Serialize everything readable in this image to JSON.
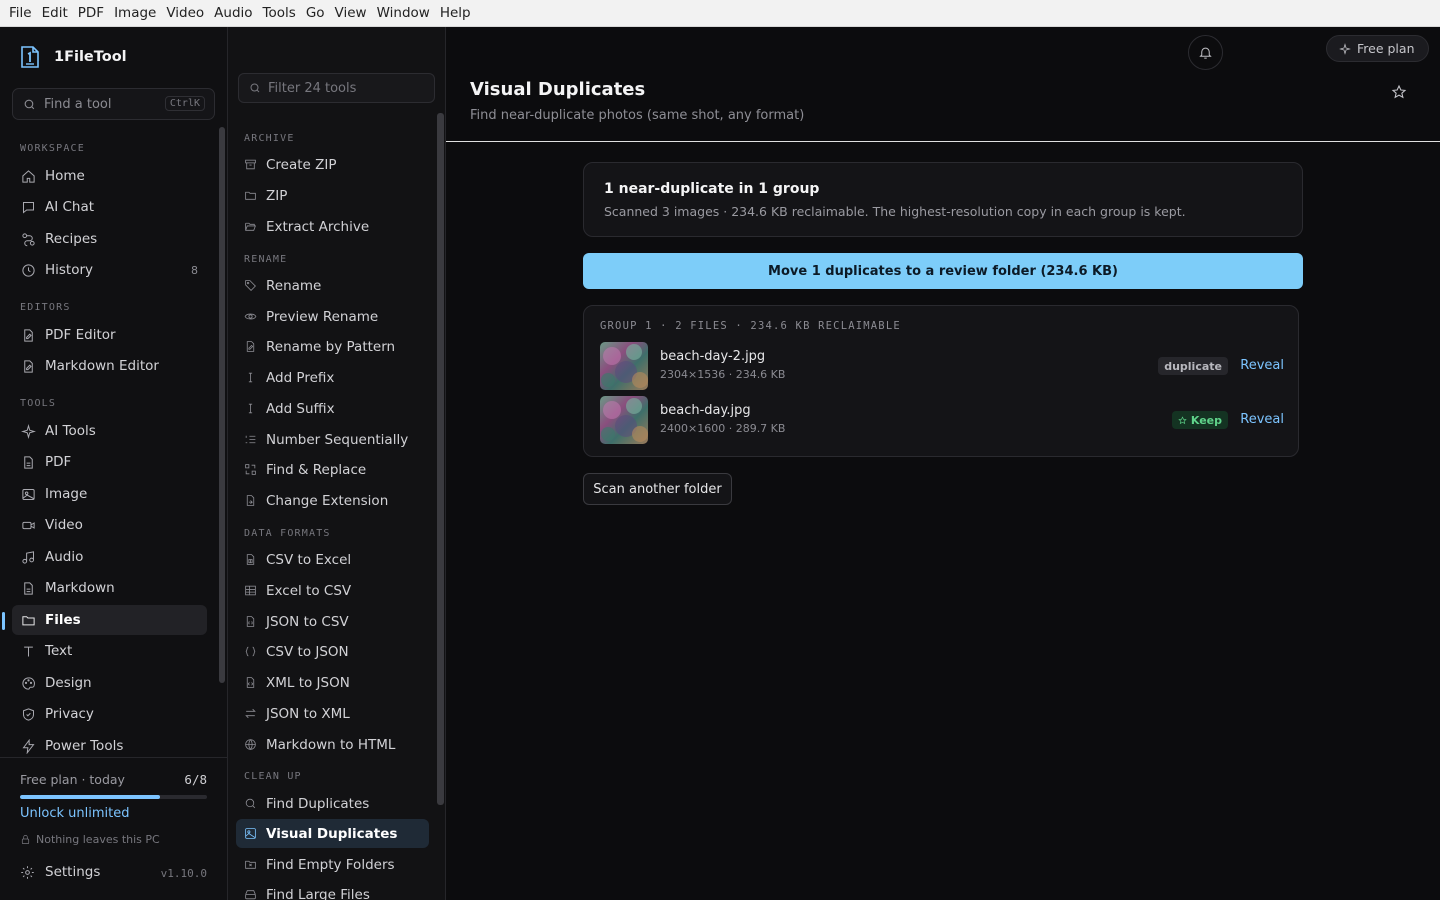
{
  "menubar": [
    "File",
    "Edit",
    "PDF",
    "Image",
    "Video",
    "Audio",
    "Tools",
    "Go",
    "View",
    "Window",
    "Help"
  ],
  "app": {
    "name": "1FileTool"
  },
  "find": {
    "placeholder": "Find a tool",
    "shortcut": "CtrlK"
  },
  "sidebar": {
    "workspace_label": "WORKSPACE",
    "workspace": [
      {
        "label": "Home",
        "icon": "home-icon"
      },
      {
        "label": "AI Chat",
        "icon": "chat-icon"
      },
      {
        "label": "Recipes",
        "icon": "recipes-icon"
      },
      {
        "label": "History",
        "icon": "history-icon",
        "count": "8"
      }
    ],
    "editors_label": "EDITORS",
    "editors": [
      {
        "label": "PDF Editor",
        "icon": "file-edit-icon"
      },
      {
        "label": "Markdown Editor",
        "icon": "file-edit-icon"
      }
    ],
    "tools_label": "TOOLS",
    "tools": [
      {
        "label": "AI Tools",
        "icon": "sparkle-icon"
      },
      {
        "label": "PDF",
        "icon": "file-icon"
      },
      {
        "label": "Image",
        "icon": "image-icon"
      },
      {
        "label": "Video",
        "icon": "video-icon"
      },
      {
        "label": "Audio",
        "icon": "music-icon"
      },
      {
        "label": "Markdown",
        "icon": "file-icon"
      },
      {
        "label": "Files",
        "icon": "folder-icon",
        "active": true
      },
      {
        "label": "Text",
        "icon": "text-icon"
      },
      {
        "label": "Design",
        "icon": "palette-icon"
      },
      {
        "label": "Privacy",
        "icon": "shield-icon"
      },
      {
        "label": "Power Tools",
        "icon": "bolt-icon"
      }
    ]
  },
  "footer": {
    "plan_label": "Free plan · today",
    "plan_count": "6/8",
    "plan_progress": 0.75,
    "unlock": "Unlock unlimited",
    "privacy": "Nothing leaves this PC",
    "settings": "Settings",
    "version": "v1.10.0"
  },
  "tools_panel": {
    "filter_placeholder": "Filter 24 tools",
    "sections": [
      {
        "label": "ARCHIVE",
        "items": [
          {
            "label": "Create ZIP",
            "icon": "archive-icon"
          },
          {
            "label": "ZIP",
            "icon": "folder-icon"
          },
          {
            "label": "Extract Archive",
            "icon": "folder-open-icon"
          }
        ]
      },
      {
        "label": "RENAME",
        "items": [
          {
            "label": "Rename",
            "icon": "tag-icon"
          },
          {
            "label": "Preview Rename",
            "icon": "eye-icon"
          },
          {
            "label": "Rename by Pattern",
            "icon": "file-edit-icon"
          },
          {
            "label": "Add Prefix",
            "icon": "text-cursor-icon"
          },
          {
            "label": "Add Suffix",
            "icon": "text-cursor-icon"
          },
          {
            "label": "Number Sequentially",
            "icon": "list-ordered-icon"
          },
          {
            "label": "Find & Replace",
            "icon": "replace-icon"
          },
          {
            "label": "Change Extension",
            "icon": "file-symlink-icon"
          }
        ]
      },
      {
        "label": "DATA FORMATS",
        "items": [
          {
            "label": "CSV to Excel",
            "icon": "file-spreadsheet-icon"
          },
          {
            "label": "Excel to CSV",
            "icon": "table-icon"
          },
          {
            "label": "JSON to CSV",
            "icon": "file-json-icon"
          },
          {
            "label": "CSV to JSON",
            "icon": "braces-icon"
          },
          {
            "label": "XML to JSON",
            "icon": "file-code-icon"
          },
          {
            "label": "JSON to XML",
            "icon": "arrows-icon"
          },
          {
            "label": "Markdown to HTML",
            "icon": "globe-icon"
          }
        ]
      },
      {
        "label": "CLEAN UP",
        "items": [
          {
            "label": "Find Duplicates",
            "icon": "search-icon"
          },
          {
            "label": "Visual Duplicates",
            "icon": "images-icon",
            "active": true
          },
          {
            "label": "Find Empty Folders",
            "icon": "folder-x-icon"
          },
          {
            "label": "Find Large Files",
            "icon": "hard-drive-icon"
          }
        ]
      }
    ]
  },
  "main": {
    "title": "Visual Duplicates",
    "subtitle": "Find near-duplicate photos (same shot, any format)",
    "free_plan": "Free plan",
    "summary_heading": "1 near-duplicate in 1 group",
    "summary_sub": "Scanned 3 images · 234.6 KB reclaimable. The highest-resolution copy in each group is kept.",
    "move_button": "Move 1 duplicates to a review folder (234.6 KB)",
    "group_header": "GROUP 1 · 2 FILES · 234.6 KB RECLAIMABLE",
    "files": [
      {
        "name": "beach-day-2.jpg",
        "meta": "2304×1536 · 234.6 KB",
        "badge": "duplicate",
        "action": "Reveal"
      },
      {
        "name": "beach-day.jpg",
        "meta": "2400×1600 · 289.7 KB",
        "badge": "Keep",
        "action": "Reveal"
      }
    ],
    "scan_button": "Scan another folder"
  }
}
